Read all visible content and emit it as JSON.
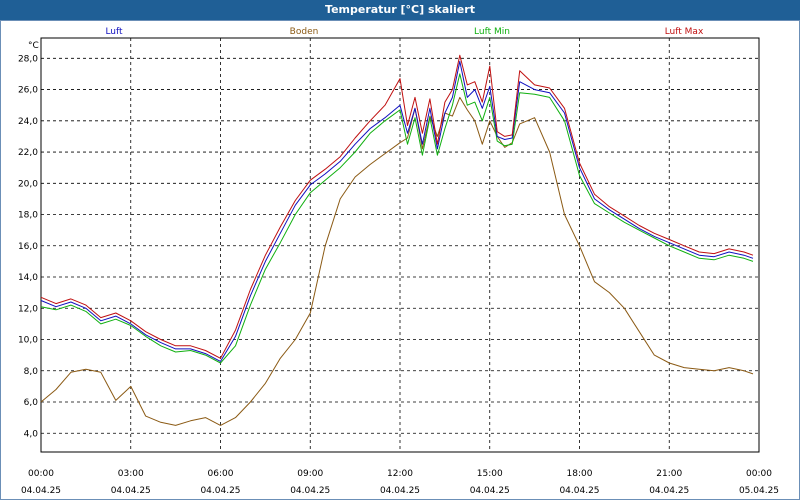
{
  "window": {
    "title": "Temperatur [°C] skaliert"
  },
  "chart_data": {
    "type": "line",
    "title": "Temperatur [°C] skaliert",
    "ylabel": "°C",
    "ylim": [
      2.8,
      29.3
    ],
    "xlim": [
      0,
      24
    ],
    "grid": true,
    "y_ticks": [
      4,
      6,
      8,
      10,
      12,
      14,
      16,
      18,
      20,
      22,
      24,
      26,
      28
    ],
    "y_tick_labels": [
      "4,0",
      "6,0",
      "8,0",
      "10,0",
      "12,0",
      "14,0",
      "16,0",
      "18,0",
      "20,0",
      "22,0",
      "24,0",
      "26,0",
      "28,0"
    ],
    "x_ticks": [
      0,
      3,
      6,
      9,
      12,
      15,
      18,
      21,
      24
    ],
    "x_tick_labels": [
      {
        "time": "00:00",
        "date": "04.04.25"
      },
      {
        "time": "03:00",
        "date": "04.04.25"
      },
      {
        "time": "06:00",
        "date": "04.04.25"
      },
      {
        "time": "09:00",
        "date": "04.04.25"
      },
      {
        "time": "12:00",
        "date": "04.04.25"
      },
      {
        "time": "15:00",
        "date": "04.04.25"
      },
      {
        "time": "18:00",
        "date": "04.04.25"
      },
      {
        "time": "21:00",
        "date": "04.04.25"
      },
      {
        "time": "00:00",
        "date": "05.04.25"
      }
    ],
    "x": [
      0,
      0.5,
      1,
      1.5,
      2,
      2.5,
      3,
      3.5,
      4,
      4.5,
      5,
      5.5,
      6,
      6.5,
      7,
      7.5,
      8,
      8.5,
      9,
      9.5,
      10,
      10.5,
      11,
      11.5,
      12,
      12.25,
      12.5,
      12.75,
      13,
      13.25,
      13.5,
      13.75,
      14,
      14.25,
      14.5,
      14.75,
      15,
      15.25,
      15.5,
      15.75,
      16,
      16.5,
      17,
      17.5,
      18,
      18.5,
      19,
      19.5,
      20,
      20.5,
      21,
      21.5,
      22,
      22.5,
      23,
      23.5,
      23.8
    ],
    "series": [
      {
        "name": "Luft",
        "color": "#1010c0",
        "values": [
          12.5,
          12.1,
          12.4,
          12.0,
          11.2,
          11.5,
          11.0,
          10.3,
          9.8,
          9.4,
          9.4,
          9.1,
          8.6,
          10.2,
          12.8,
          15.0,
          16.8,
          18.6,
          19.9,
          20.6,
          21.4,
          22.5,
          23.5,
          24.2,
          25.0,
          23.2,
          24.8,
          22.5,
          24.8,
          22.2,
          24.5,
          25.5,
          27.8,
          25.5,
          26.0,
          24.8,
          26.2,
          23.0,
          22.8,
          22.9,
          26.5,
          26.0,
          25.8,
          24.5,
          21.0,
          19.0,
          18.3,
          17.7,
          17.1,
          16.6,
          16.2,
          15.8,
          15.4,
          15.3,
          15.6,
          15.4,
          15.2
        ]
      },
      {
        "name": "Boden",
        "color": "#8b5a14",
        "values": [
          6.0,
          6.8,
          7.9,
          8.1,
          7.9,
          6.1,
          7.0,
          5.1,
          4.7,
          4.5,
          4.8,
          5.0,
          4.5,
          5.0,
          6.0,
          7.2,
          8.8,
          10.0,
          11.7,
          16.0,
          19.0,
          20.4,
          21.2,
          21.9,
          22.6,
          22.9,
          24.8,
          22.2,
          24.3,
          23.0,
          24.5,
          24.3,
          25.5,
          24.7,
          24.0,
          22.5,
          24.0,
          23.0,
          22.3,
          22.6,
          23.8,
          24.2,
          22.0,
          18.0,
          16.0,
          13.7,
          13.0,
          12.0,
          10.5,
          9.0,
          8.5,
          8.2,
          8.1,
          8.0,
          8.2,
          8.0,
          7.8
        ]
      },
      {
        "name": "Luft Min",
        "color": "#10b010",
        "values": [
          12.1,
          11.9,
          12.2,
          11.8,
          11.0,
          11.3,
          10.9,
          10.2,
          9.6,
          9.2,
          9.3,
          9.0,
          8.5,
          9.6,
          12.2,
          14.5,
          16.2,
          18.0,
          19.4,
          20.2,
          21.0,
          22.0,
          23.2,
          24.0,
          24.7,
          22.5,
          24.2,
          21.8,
          24.2,
          21.8,
          23.5,
          25.0,
          27.0,
          25.0,
          25.2,
          24.0,
          25.5,
          22.7,
          22.4,
          22.5,
          25.8,
          25.7,
          25.5,
          24.0,
          20.5,
          18.7,
          18.1,
          17.5,
          17.0,
          16.5,
          16.0,
          15.6,
          15.2,
          15.1,
          15.4,
          15.2,
          15.0
        ]
      },
      {
        "name": "Luft Max",
        "color": "#c01010",
        "values": [
          12.7,
          12.3,
          12.6,
          12.2,
          11.4,
          11.7,
          11.2,
          10.5,
          10.0,
          9.6,
          9.6,
          9.3,
          8.8,
          10.6,
          13.2,
          15.4,
          17.2,
          18.9,
          20.2,
          20.9,
          21.7,
          22.9,
          24.0,
          25.0,
          26.7,
          23.7,
          25.5,
          23.2,
          25.4,
          22.5,
          25.2,
          26.0,
          28.2,
          26.3,
          26.5,
          25.2,
          27.5,
          23.3,
          23.0,
          23.1,
          27.2,
          26.3,
          26.1,
          24.8,
          21.3,
          19.3,
          18.5,
          17.9,
          17.3,
          16.8,
          16.4,
          16.0,
          15.6,
          15.5,
          15.8,
          15.6,
          15.4
        ]
      }
    ]
  }
}
